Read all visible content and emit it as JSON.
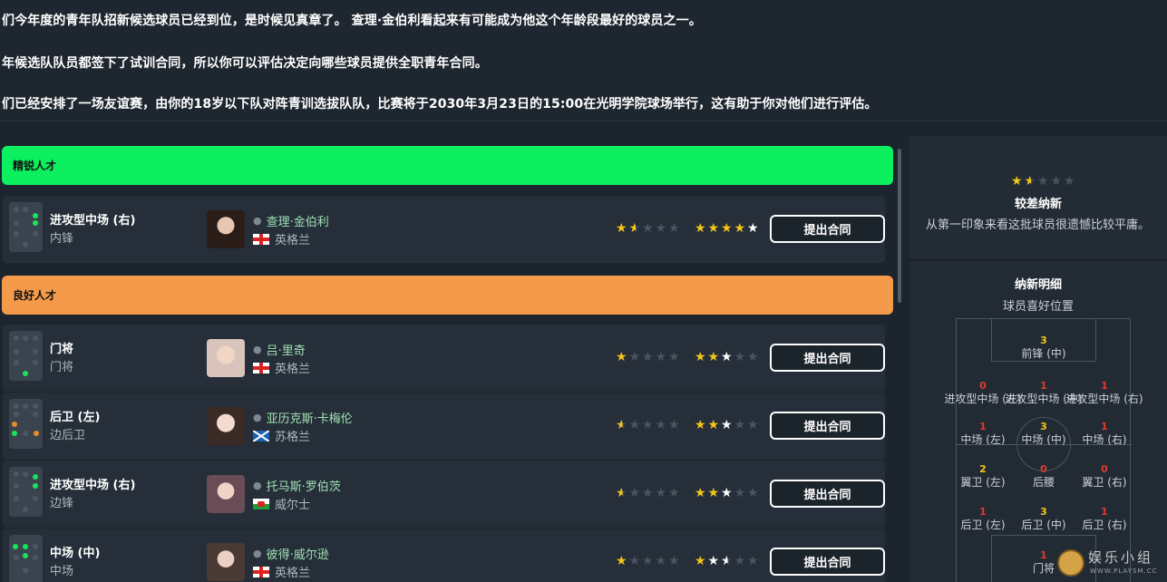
{
  "intro": {
    "line1": "们今年度的青年队招新候选球员已经到位，是时候见真章了。 查理·金伯利看起来有可能成为他这个年龄段最好的球员之一。",
    "line2": "年候选队队员都签下了试训合同，所以你可以评估决定向哪些球员提供全职青年合同。",
    "line3": "们已经安排了一场友谊赛，由你的18岁以下队对阵青训选拔队队，比赛将于2030年3月23日的15:00在光明学院球场举行，这有助于你对他们进行评估。"
  },
  "groups": [
    {
      "label": "精锐人才"
    },
    {
      "label": "良好人才"
    }
  ],
  "players": [
    {
      "position": "进攻型中场 (右)",
      "role": "内锋",
      "name": "查理·金伯利",
      "nation": "英格兰",
      "flag": "england",
      "current_ability": 1.5,
      "potential_ability": 5,
      "offer_label": "提出合同"
    },
    {
      "position": "门将",
      "role": "门将",
      "name": "吕·里奇",
      "nation": "英格兰",
      "flag": "england",
      "current_ability": 1,
      "potential_ability": 3,
      "offer_label": "提出合同"
    },
    {
      "position": "后卫 (左)",
      "role": "边后卫",
      "name": "亚历克斯·卡梅伦",
      "nation": "苏格兰",
      "flag": "scotland",
      "current_ability": 0.5,
      "potential_ability": 3,
      "offer_label": "提出合同"
    },
    {
      "position": "进攻型中场 (右)",
      "role": "边锋",
      "name": "托马斯·罗伯茨",
      "nation": "威尔士",
      "flag": "wales",
      "current_ability": 0.5,
      "potential_ability": 3,
      "offer_label": "提出合同"
    },
    {
      "position": "中场 (中)",
      "role": "中场",
      "name": "彼得·威尔逊",
      "nation": "英格兰",
      "flag": "england",
      "current_ability": 1,
      "potential_ability": 2.5,
      "offer_label": "提出合同"
    }
  ],
  "summary": {
    "rating": 1.5,
    "title": "较差纳新",
    "description": "从第一印象来看这批球员很遗憾比较平庸。"
  },
  "detail": {
    "title": "纳新明细",
    "subtitle": "球员喜好位置",
    "zones": {
      "st": {
        "count": "3",
        "label": "前锋 (中)"
      },
      "aml": {
        "count": "0",
        "label": "进攻型中场 (左)"
      },
      "amc": {
        "count": "1",
        "label": "进攻型中场 (中)"
      },
      "amr": {
        "count": "1",
        "label": "进攻型中场 (右)"
      },
      "ml": {
        "count": "1",
        "label": "中场 (左)"
      },
      "mc": {
        "count": "3",
        "label": "中场 (中)"
      },
      "mr": {
        "count": "1",
        "label": "中场 (右)"
      },
      "wbl": {
        "count": "2",
        "label": "翼卫 (左)"
      },
      "dm": {
        "count": "0",
        "label": "后腰"
      },
      "wbr": {
        "count": "0",
        "label": "翼卫 (右)"
      },
      "dl": {
        "count": "1",
        "label": "后卫 (左)"
      },
      "dc": {
        "count": "3",
        "label": "后卫 (中)"
      },
      "dr": {
        "count": "1",
        "label": "后卫 (右)"
      },
      "gk": {
        "count": "1",
        "label": "门将"
      }
    }
  },
  "watermark": {
    "text": "娱乐小组",
    "url": "WWW.PLAYSM.CC"
  },
  "colors": {
    "elite": "#0cf05f",
    "good": "#f49a4a",
    "star": "#f5c518"
  }
}
